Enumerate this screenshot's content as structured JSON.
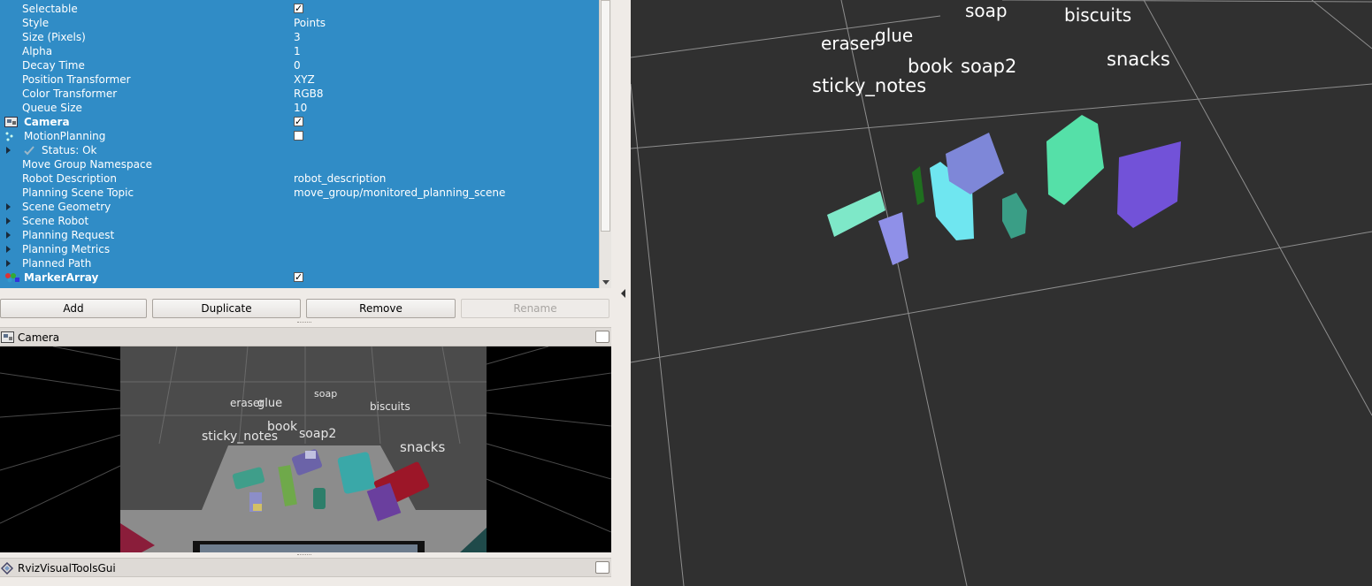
{
  "tree": {
    "rows": [
      {
        "label": "Selectable",
        "value": "",
        "checkbox": true,
        "checked": true
      },
      {
        "label": "Style",
        "value": "Points"
      },
      {
        "label": "Size (Pixels)",
        "value": "3"
      },
      {
        "label": "Alpha",
        "value": "1"
      },
      {
        "label": "Decay Time",
        "value": "0"
      },
      {
        "label": "Position Transformer",
        "value": "XYZ"
      },
      {
        "label": "Color Transformer",
        "value": "RGB8"
      },
      {
        "label": "Queue Size",
        "value": "10"
      },
      {
        "label": "Camera",
        "value": "",
        "checkbox": true,
        "checked": true,
        "bold": true,
        "icon": "camera-display-icon"
      },
      {
        "label": "MotionPlanning",
        "value": "",
        "checkbox": true,
        "checked": false,
        "icon": "motion-planning-icon"
      },
      {
        "label": "Status: Ok",
        "value": "",
        "expander": true,
        "icon": "status-ok-check-icon"
      },
      {
        "label": "Move Group Namespace",
        "value": ""
      },
      {
        "label": "Robot Description",
        "value": "robot_description"
      },
      {
        "label": "Planning Scene Topic",
        "value": "move_group/monitored_planning_scene"
      },
      {
        "label": "Scene Geometry",
        "value": "",
        "expander": true
      },
      {
        "label": "Scene Robot",
        "value": "",
        "expander": true
      },
      {
        "label": "Planning Request",
        "value": "",
        "expander": true
      },
      {
        "label": "Planning Metrics",
        "value": "",
        "expander": true
      },
      {
        "label": "Planned Path",
        "value": "",
        "expander": true
      },
      {
        "label": "MarkerArray",
        "value": "",
        "checkbox": true,
        "checked": true,
        "bold": true,
        "icon": "marker-array-icon"
      }
    ]
  },
  "buttons": {
    "add": "Add",
    "duplicate": "Duplicate",
    "remove": "Remove",
    "rename": "Rename"
  },
  "panels": {
    "camera_title": "Camera",
    "rviz_title": "RvizVisualToolsGui"
  },
  "camera_labels": [
    "eraser",
    "glue",
    "soap",
    "biscuits",
    "sticky_notes",
    "book",
    "soap2",
    "snacks"
  ],
  "viewport_labels": [
    "eraser",
    "glue",
    "soap",
    "biscuits",
    "book",
    "soap2",
    "snacks",
    "sticky_notes"
  ],
  "colors": {
    "selection_blue": "#308cc6",
    "viewport_bg": "#303030",
    "grid": "#9a9a9a"
  }
}
